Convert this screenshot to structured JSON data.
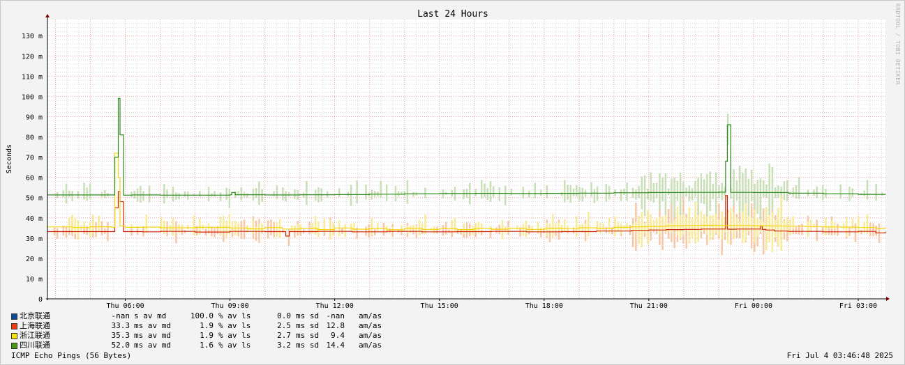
{
  "chart_data": {
    "type": "line",
    "title": "Last 24 Hours",
    "ylabel": "Seconds",
    "xlabel": "",
    "ylim": [
      0,
      138
    ],
    "y_ticks": [
      {
        "value": 0,
        "label": "0"
      },
      {
        "value": 10,
        "label": "10 m"
      },
      {
        "value": 20,
        "label": "20 m"
      },
      {
        "value": 30,
        "label": "30 m"
      },
      {
        "value": 40,
        "label": "40 m"
      },
      {
        "value": 50,
        "label": "50 m"
      },
      {
        "value": 60,
        "label": "60 m"
      },
      {
        "value": 70,
        "label": "70 m"
      },
      {
        "value": 80,
        "label": "80 m"
      },
      {
        "value": 90,
        "label": "90 m"
      },
      {
        "value": 100,
        "label": "100 m"
      },
      {
        "value": 110,
        "label": "110 m"
      },
      {
        "value": 120,
        "label": "120 m"
      },
      {
        "value": 130,
        "label": "130 m"
      }
    ],
    "x_range_hours": [
      3.77,
      27.78
    ],
    "x_ticks": [
      {
        "hour": 6,
        "label": "Thu 06:00"
      },
      {
        "hour": 9,
        "label": "Thu 09:00"
      },
      {
        "hour": 12,
        "label": "Thu 12:00"
      },
      {
        "hour": 15,
        "label": "Thu 15:00"
      },
      {
        "hour": 18,
        "label": "Thu 18:00"
      },
      {
        "hour": 21,
        "label": "Thu 21:00"
      },
      {
        "hour": 24,
        "label": "Fri 00:00"
      },
      {
        "hour": 27,
        "label": "Fri 03:00"
      }
    ],
    "grid": true,
    "series": [
      {
        "name": "北京联通",
        "color": "#0e4a9a",
        "x": [],
        "y": []
      },
      {
        "name": "上海联通",
        "color": "#cc2200",
        "x": [
          3.77,
          5.6,
          5.7,
          5.8,
          5.85,
          5.95,
          6.2,
          6.5,
          7.0,
          8.0,
          9.0,
          10.0,
          10.6,
          10.7,
          10.8,
          11.5,
          12.5,
          13.5,
          14.5,
          15.5,
          16.5,
          17.5,
          18.5,
          19.5,
          20.5,
          21.0,
          21.5,
          22.0,
          22.5,
          23.0,
          23.2,
          23.25,
          23.35,
          23.5,
          24.0,
          24.2,
          24.25,
          24.35,
          24.6,
          25.0,
          26.0,
          27.0,
          27.5,
          27.78
        ],
        "y": [
          33.2,
          33.2,
          45,
          53,
          48,
          33.2,
          33.2,
          33.1,
          33.3,
          33.0,
          33.3,
          33.2,
          31,
          33.2,
          33.2,
          33.3,
          33.1,
          33.3,
          33.1,
          33.2,
          33.3,
          33.1,
          33.2,
          33.5,
          33.8,
          34.0,
          34.2,
          34.3,
          34.5,
          34.5,
          51,
          34.4,
          34.4,
          34.5,
          34.5,
          36,
          34.3,
          34.0,
          33.5,
          33.3,
          33.1,
          33.3,
          32.6,
          33.1
        ]
      },
      {
        "name": "浙江联通",
        "color": "#f5d60c",
        "x": [
          3.77,
          4.5,
          5.0,
          5.6,
          5.7,
          5.8,
          5.85,
          6.0,
          6.5,
          7.0,
          8.0,
          9.0,
          9.5,
          10.0,
          10.5,
          11.0,
          11.5,
          12.0,
          12.5,
          13.0,
          13.5,
          14.0,
          14.5,
          15.0,
          15.5,
          16.0,
          16.5,
          17.0,
          17.5,
          18.0,
          18.5,
          19.0,
          19.5,
          20.0,
          20.5,
          21.0,
          21.5,
          22.0,
          22.5,
          23.0,
          23.5,
          24.0,
          24.5,
          25.0,
          25.5,
          26.0,
          26.5,
          27.0,
          27.5,
          27.78
        ],
        "y": [
          35.5,
          35.2,
          35.6,
          35.3,
          72,
          60,
          36,
          35.3,
          35.4,
          35.1,
          35.3,
          35.0,
          34.6,
          35.2,
          34.5,
          34.9,
          34.2,
          35.0,
          34.4,
          34.8,
          34.1,
          34.9,
          34.3,
          34.8,
          34.2,
          34.9,
          34.4,
          34.8,
          34.3,
          34.9,
          34.7,
          35.1,
          34.9,
          35.3,
          35.6,
          35.8,
          36.1,
          36.2,
          36.3,
          36.2,
          36.2,
          36.1,
          36.0,
          35.9,
          35.7,
          35.5,
          35.4,
          35.2,
          34.8,
          35.2
        ]
      },
      {
        "name": "四川联通",
        "color": "#2a8a1a",
        "x": [
          3.77,
          5.6,
          5.7,
          5.8,
          5.85,
          5.95,
          6.2,
          7.0,
          8.0,
          9.0,
          9.05,
          9.15,
          10.0,
          11.0,
          12.0,
          13.0,
          14.0,
          15.0,
          16.0,
          17.0,
          18.0,
          19.0,
          20.0,
          21.0,
          22.0,
          23.0,
          23.2,
          23.25,
          23.35,
          23.5,
          24.0,
          25.0,
          26.0,
          27.0,
          27.78
        ],
        "y": [
          51.3,
          51.3,
          70,
          99,
          81,
          51.2,
          51.3,
          51.2,
          51.2,
          51.4,
          52.5,
          51.4,
          51.3,
          51.4,
          51.5,
          51.7,
          51.9,
          52.0,
          52.1,
          52.0,
          52.1,
          52.2,
          52.4,
          52.5,
          52.6,
          52.7,
          68,
          86,
          52.6,
          52.6,
          52.5,
          52.2,
          51.9,
          51.6,
          51.5
        ]
      }
    ],
    "legend": {
      "position": "bottom-left",
      "rows": [
        {
          "name": "北京联通",
          "color": "#0e4a9a",
          "avg": "-nan",
          "avg_unit": "s av md",
          "loss": "100.0",
          "loss_unit": "% av ls",
          "sd": "0.0",
          "sd_unit": "ms sd",
          "amas": "-nan",
          "amas_unit": "am/as"
        },
        {
          "name": "上海联通",
          "color": "#f23a0f",
          "avg": "33.3",
          "avg_unit": "ms av md",
          "loss": "1.9",
          "loss_unit": "% av ls",
          "sd": "2.5",
          "sd_unit": "ms sd",
          "amas": "12.8",
          "amas_unit": "am/as"
        },
        {
          "name": "浙江联通",
          "color": "#f5e40c",
          "avg": "35.3",
          "avg_unit": "ms av md",
          "loss": "1.9",
          "loss_unit": "% av ls",
          "sd": "2.7",
          "sd_unit": "ms sd",
          "amas": "9.4",
          "amas_unit": "am/as"
        },
        {
          "name": "四川联通",
          "color": "#4a9a1a",
          "avg": "52.0",
          "avg_unit": "ms av md",
          "loss": "1.6",
          "loss_unit": "% av ls",
          "sd": "3.2",
          "sd_unit": "ms sd",
          "amas": "14.4",
          "amas_unit": "am/as"
        }
      ]
    }
  },
  "footer": {
    "left": "ICMP Echo Pings (56 Bytes)",
    "right": "Fri Jul  4 03:46:48 2025"
  },
  "watermark": "RRDTOOL / TOBI OETIKER",
  "colors": {
    "grid_major": "#e8a0a0",
    "grid_minor": "#d8d8d8",
    "plot_bg": "#ffffff",
    "axis": "#7a0000"
  }
}
